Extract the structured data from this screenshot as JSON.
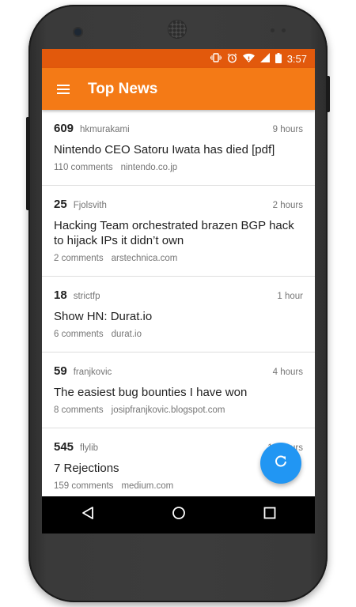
{
  "status_bar": {
    "time": "3:57",
    "icons": [
      "vibrate-icon",
      "alarm-icon",
      "wifi-icon",
      "signal-icon",
      "battery-icon"
    ]
  },
  "app_bar": {
    "title": "Top News",
    "menu_icon": "hamburger-menu-icon"
  },
  "stories": [
    {
      "points": "609",
      "author": "hkmurakami",
      "time": "9 hours",
      "title": "Nintendo CEO Satoru Iwata has died [pdf]",
      "comments": "110 comments",
      "domain": "nintendo.co.jp"
    },
    {
      "points": "25",
      "author": "Fjolsvith",
      "time": "2 hours",
      "title": "Hacking Team orchestrated brazen BGP hack to hijack IPs it didn’t own",
      "comments": "2 comments",
      "domain": "arstechnica.com"
    },
    {
      "points": "18",
      "author": "strictfp",
      "time": "1 hour",
      "title": "Show HN: Durat.io",
      "comments": "6 comments",
      "domain": "durat.io"
    },
    {
      "points": "59",
      "author": "franjkovic",
      "time": "4 hours",
      "title": "The easiest bug bounties I have won",
      "comments": "8 comments",
      "domain": "josipfranjkovic.blogspot.com"
    },
    {
      "points": "545",
      "author": "flylib",
      "time": "14 hours",
      "title": "7 Rejections",
      "comments": "159 comments",
      "domain": "medium.com"
    }
  ],
  "fab": {
    "icon": "refresh-icon"
  },
  "nav_bar": {
    "icons": [
      "back-icon",
      "home-icon",
      "recents-icon"
    ]
  },
  "colors": {
    "status_bar": "#e2590c",
    "app_bar": "#f47a16",
    "fab": "#2196f3"
  }
}
